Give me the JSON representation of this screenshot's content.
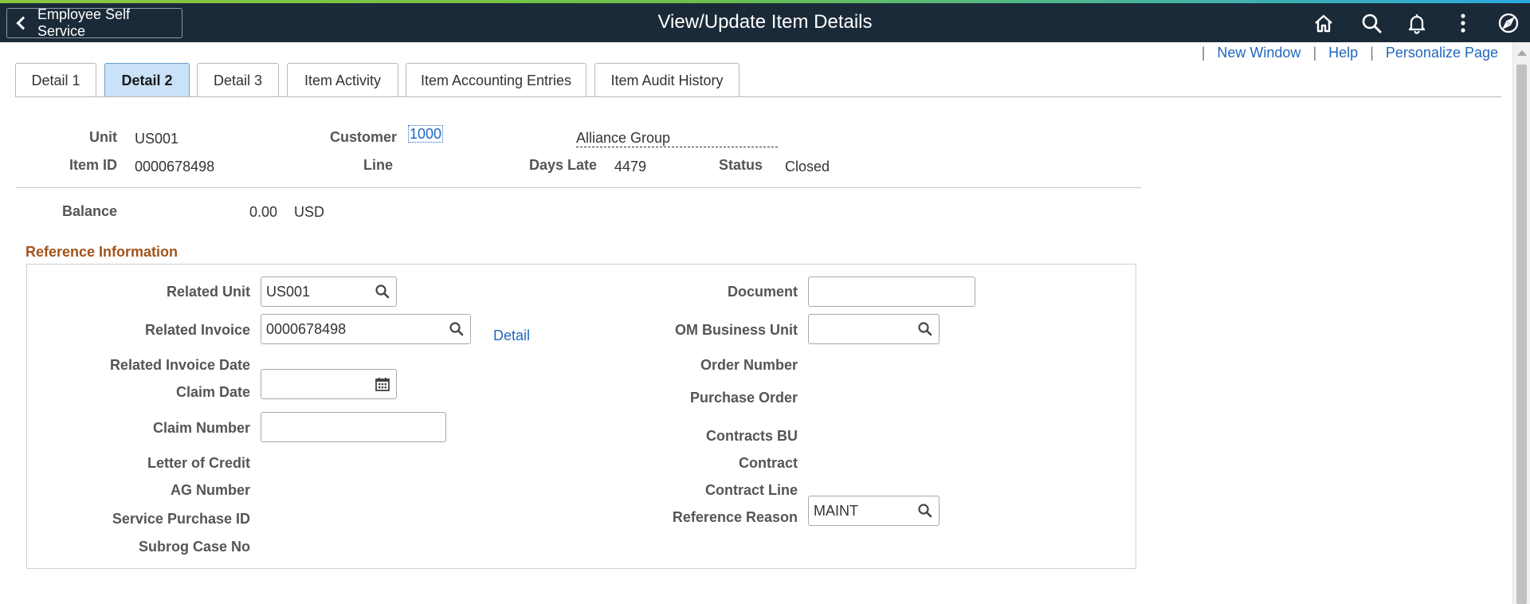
{
  "header": {
    "back_label": "Employee Self Service",
    "title": "View/Update Item Details",
    "icons": [
      "home-icon",
      "search-icon",
      "bell-icon",
      "more-vertical-icon",
      "compass-icon"
    ]
  },
  "top_links": {
    "new_window": "New Window",
    "help": "Help",
    "personalize": "Personalize Page",
    "separator": "|"
  },
  "tabs": [
    {
      "label": "Detail 1",
      "active": false
    },
    {
      "label": "Detail 2",
      "active": true
    },
    {
      "label": "Detail 3",
      "active": false
    },
    {
      "label": "Item Activity",
      "active": false
    },
    {
      "label": "Item Accounting Entries",
      "active": false
    },
    {
      "label": "Item Audit History",
      "active": false
    }
  ],
  "summary": {
    "unit_label": "Unit",
    "unit_value": "US001",
    "customer_label": "Customer",
    "customer_value": "1000",
    "customer_name": "Alliance Group",
    "item_id_label": "Item ID",
    "item_id_value": "0000678498",
    "line_label": "Line",
    "days_late_label": "Days Late",
    "days_late_value": "4479",
    "status_label": "Status",
    "status_value": "Closed",
    "balance_label": "Balance",
    "balance_value": "0.00",
    "currency": "USD"
  },
  "reference": {
    "title": "Reference Information",
    "related_unit_label": "Related Unit",
    "related_unit_value": "US001",
    "related_invoice_label": "Related Invoice",
    "related_invoice_value": "0000678498",
    "detail_link": "Detail",
    "related_invoice_date_label": "Related Invoice Date",
    "claim_date_label": "Claim Date",
    "claim_date_value": "",
    "claim_number_label": "Claim Number",
    "claim_number_value": "",
    "letter_of_credit_label": "Letter of Credit",
    "ag_number_label": "AG Number",
    "service_purchase_id_label": "Service Purchase ID",
    "subrog_case_no_label": "Subrog Case No",
    "document_label": "Document",
    "document_value": "",
    "om_business_unit_label": "OM Business Unit",
    "om_business_unit_value": "",
    "order_number_label": "Order Number",
    "purchase_order_label": "Purchase Order",
    "contracts_bu_label": "Contracts BU",
    "contract_label": "Contract",
    "contract_line_label": "Contract Line",
    "reference_reason_label": "Reference Reason",
    "reference_reason_value": "MAINT"
  },
  "colors": {
    "header_bg": "#1b2a38",
    "link": "#1f68c1",
    "section_title": "#a0531b",
    "active_tab": "#c9e2f7"
  }
}
